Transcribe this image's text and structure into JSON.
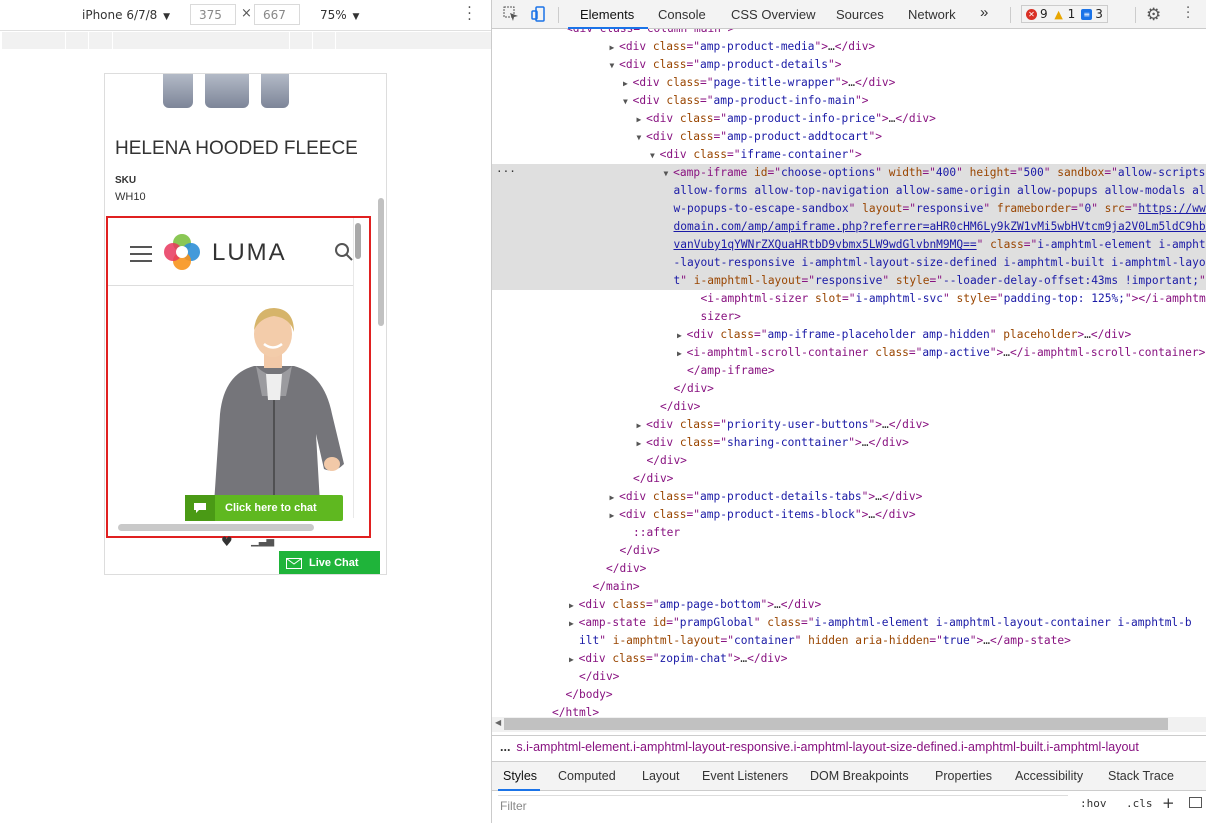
{
  "device_toolbar": {
    "device": "iPhone 6/7/8",
    "width": "375",
    "height": "667",
    "times": "×",
    "zoom": "75%"
  },
  "phone": {
    "product_title": "HELENA HOODED FLEECE",
    "sku_label": "SKU",
    "sku_value": "WH10",
    "brand": "LUMA",
    "chat_button": "Click here to chat",
    "live_chat": "Live Chat"
  },
  "devtools": {
    "tabs": [
      "Elements",
      "Console",
      "CSS Overview",
      "Sources",
      "Network"
    ],
    "more_tabs": "»",
    "errors": "9",
    "warnings": "1",
    "messages": "3",
    "breadcrumb": "s.i-amphtml-element.i-amphtml-layout-responsive.i-amphtml-layout-size-defined.i-amphtml-built.i-amphtml-layout",
    "bottom_tabs": [
      "Styles",
      "Computed",
      "Layout",
      "Event Listeners",
      "DOM Breakpoints",
      "Properties",
      "Accessibility",
      "Stack Trace"
    ],
    "filter_placeholder": "Filter",
    "hov": ":hov",
    "cls": ".cls",
    "plus": "+"
  },
  "dom_lines": [
    {
      "i": 5,
      "t": "▶",
      "seg": [
        [
          "tg",
          "<div "
        ],
        [
          "an",
          "class"
        ],
        [
          "tg",
          "=\""
        ],
        [
          "av",
          "amp-product-media"
        ],
        [
          "tg",
          "\">"
        ],
        [
          "tx",
          "…"
        ],
        [
          "tg",
          "</div>"
        ]
      ]
    },
    {
      "i": 5,
      "t": "▼",
      "seg": [
        [
          "tg",
          "<div "
        ],
        [
          "an",
          "class"
        ],
        [
          "tg",
          "=\""
        ],
        [
          "av",
          "amp-product-details"
        ],
        [
          "tg",
          "\">"
        ]
      ]
    },
    {
      "i": 6,
      "t": "▶",
      "seg": [
        [
          "tg",
          "<div "
        ],
        [
          "an",
          "class"
        ],
        [
          "tg",
          "=\""
        ],
        [
          "av",
          "page-title-wrapper"
        ],
        [
          "tg",
          "\">"
        ],
        [
          "tx",
          "…"
        ],
        [
          "tg",
          "</div>"
        ]
      ]
    },
    {
      "i": 6,
      "t": "▼",
      "seg": [
        [
          "tg",
          "<div "
        ],
        [
          "an",
          "class"
        ],
        [
          "tg",
          "=\""
        ],
        [
          "av",
          "amp-product-info-main"
        ],
        [
          "tg",
          "\">"
        ]
      ]
    },
    {
      "i": 7,
      "t": "▶",
      "seg": [
        [
          "tg",
          "<div "
        ],
        [
          "an",
          "class"
        ],
        [
          "tg",
          "=\""
        ],
        [
          "av",
          "amp-product-info-price"
        ],
        [
          "tg",
          "\">"
        ],
        [
          "tx",
          "…"
        ],
        [
          "tg",
          "</div>"
        ]
      ]
    },
    {
      "i": 7,
      "t": "▼",
      "seg": [
        [
          "tg",
          "<div "
        ],
        [
          "an",
          "class"
        ],
        [
          "tg",
          "=\""
        ],
        [
          "av",
          "amp-product-addtocart"
        ],
        [
          "tg",
          "\">"
        ]
      ]
    },
    {
      "i": 8,
      "t": "▼",
      "seg": [
        [
          "tg",
          "<div "
        ],
        [
          "an",
          "class"
        ],
        [
          "tg",
          "=\""
        ],
        [
          "av",
          "iframe-container"
        ],
        [
          "tg",
          "\">"
        ]
      ]
    },
    {
      "i": 9,
      "t": "▼",
      "hl": true,
      "seg": [
        [
          "tg",
          "<amp-iframe "
        ],
        [
          "an",
          "id"
        ],
        [
          "tg",
          "=\""
        ],
        [
          "av",
          "choose-options"
        ],
        [
          "tg",
          "\" "
        ],
        [
          "an",
          "width"
        ],
        [
          "tg",
          "=\""
        ],
        [
          "av",
          "400"
        ],
        [
          "tg",
          "\" "
        ],
        [
          "an",
          "height"
        ],
        [
          "tg",
          "=\""
        ],
        [
          "av",
          "500"
        ],
        [
          "tg",
          "\" "
        ],
        [
          "an",
          "sandbox"
        ],
        [
          "tg",
          "=\""
        ],
        [
          "av",
          "allow-scripts"
        ]
      ]
    },
    {
      "i": 9,
      "t": "",
      "hl": true,
      "seg": [
        [
          "av",
          "allow-forms allow-top-navigation allow-same-origin allow-popups allow-modals allo"
        ]
      ]
    },
    {
      "i": 9,
      "t": "",
      "hl": true,
      "seg": [
        [
          "av",
          "w-popups-to-escape-sandbox"
        ],
        [
          "tg",
          "\" "
        ],
        [
          "an",
          "layout"
        ],
        [
          "tg",
          "=\""
        ],
        [
          "av",
          "responsive"
        ],
        [
          "tg",
          "\" "
        ],
        [
          "an",
          "frameborder"
        ],
        [
          "tg",
          "=\""
        ],
        [
          "av",
          "0"
        ],
        [
          "tg",
          "\" "
        ],
        [
          "an",
          "src"
        ],
        [
          "tg",
          "=\""
        ],
        [
          "lk",
          "https://www."
        ]
      ]
    },
    {
      "i": 9,
      "t": "",
      "hl": true,
      "seg": [
        [
          "lk",
          "domain.com/amp/ampiframe.php?referrer=aHR0cHM6Ly9kZW1vMi5wbHVtcm9ja2V0Lm5ldC9hbX"
        ]
      ]
    },
    {
      "i": 9,
      "t": "",
      "hl": true,
      "seg": [
        [
          "lk",
          "vanVuby1qYWNrZXQuaHRtbD9vbmx5LW9wdGlvbnM9MQ=="
        ],
        [
          "tg",
          "\" "
        ],
        [
          "an",
          "class"
        ],
        [
          "tg",
          "=\""
        ],
        [
          "av",
          "i-amphtml-element i-amphtm"
        ]
      ]
    },
    {
      "i": 9,
      "t": "",
      "hl": true,
      "seg": [
        [
          "av",
          "-layout-responsive i-amphtml-layout-size-defined i-amphtml-built i-amphtml-layou"
        ]
      ]
    },
    {
      "i": 9,
      "t": "",
      "hl": true,
      "seg": [
        [
          "av",
          "t"
        ],
        [
          "tg",
          "\" "
        ],
        [
          "an",
          "i-amphtml-layout"
        ],
        [
          "tg",
          "=\""
        ],
        [
          "av",
          "responsive"
        ],
        [
          "tg",
          "\" "
        ],
        [
          "an",
          "style"
        ],
        [
          "tg",
          "=\""
        ],
        [
          "av",
          "--loader-delay-offset:43ms !important;"
        ],
        [
          "tg",
          "\">"
        ]
      ]
    },
    {
      "i": 11,
      "t": "",
      "seg": [
        [
          "tg",
          "<i-amphtml-sizer "
        ],
        [
          "an",
          "slot"
        ],
        [
          "tg",
          "=\""
        ],
        [
          "av",
          "i-amphtml-svc"
        ],
        [
          "tg",
          "\" "
        ],
        [
          "an",
          "style"
        ],
        [
          "tg",
          "=\""
        ],
        [
          "av",
          "padding-top: 125%;"
        ],
        [
          "tg",
          "\"></i-amphtml-"
        ]
      ]
    },
    {
      "i": 11,
      "t": "",
      "seg": [
        [
          "tg",
          "sizer>"
        ]
      ]
    },
    {
      "i": 10,
      "t": "▶",
      "seg": [
        [
          "tg",
          "<div "
        ],
        [
          "an",
          "class"
        ],
        [
          "tg",
          "=\""
        ],
        [
          "av",
          "amp-iframe-placeholder amp-hidden"
        ],
        [
          "tg",
          "\" "
        ],
        [
          "an",
          "placeholder"
        ],
        [
          "tg",
          ">"
        ],
        [
          "tx",
          "…"
        ],
        [
          "tg",
          "</div>"
        ]
      ]
    },
    {
      "i": 10,
      "t": "▶",
      "seg": [
        [
          "tg",
          "<i-amphtml-scroll-container "
        ],
        [
          "an",
          "class"
        ],
        [
          "tg",
          "=\""
        ],
        [
          "av",
          "amp-active"
        ],
        [
          "tg",
          "\">"
        ],
        [
          "tx",
          "…"
        ],
        [
          "tg",
          "</i-amphtml-scroll-container>"
        ]
      ]
    },
    {
      "i": 10,
      "t": "",
      "seg": [
        [
          "tg",
          "</amp-iframe>"
        ]
      ]
    },
    {
      "i": 9,
      "t": "",
      "seg": [
        [
          "tg",
          "</div>"
        ]
      ]
    },
    {
      "i": 8,
      "t": "",
      "seg": [
        [
          "tg",
          "</div>"
        ]
      ]
    },
    {
      "i": 7,
      "t": "▶",
      "seg": [
        [
          "tg",
          "<div "
        ],
        [
          "an",
          "class"
        ],
        [
          "tg",
          "=\""
        ],
        [
          "av",
          "priority-user-buttons"
        ],
        [
          "tg",
          "\">"
        ],
        [
          "tx",
          "…"
        ],
        [
          "tg",
          "</div>"
        ]
      ]
    },
    {
      "i": 7,
      "t": "▶",
      "seg": [
        [
          "tg",
          "<div "
        ],
        [
          "an",
          "class"
        ],
        [
          "tg",
          "=\""
        ],
        [
          "av",
          "sharing-conttainer"
        ],
        [
          "tg",
          "\">"
        ],
        [
          "tx",
          "…"
        ],
        [
          "tg",
          "</div>"
        ]
      ]
    },
    {
      "i": 7,
      "t": "",
      "seg": [
        [
          "tg",
          "</div>"
        ]
      ]
    },
    {
      "i": 6,
      "t": "",
      "seg": [
        [
          "tg",
          "</div>"
        ]
      ]
    },
    {
      "i": 5,
      "t": "▶",
      "seg": [
        [
          "tg",
          "<div "
        ],
        [
          "an",
          "class"
        ],
        [
          "tg",
          "=\""
        ],
        [
          "av",
          "amp-product-details-tabs"
        ],
        [
          "tg",
          "\">"
        ],
        [
          "tx",
          "…"
        ],
        [
          "tg",
          "</div>"
        ]
      ]
    },
    {
      "i": 5,
      "t": "▶",
      "seg": [
        [
          "tg",
          "<div "
        ],
        [
          "an",
          "class"
        ],
        [
          "tg",
          "=\""
        ],
        [
          "av",
          "amp-product-items-block"
        ],
        [
          "tg",
          "\">"
        ],
        [
          "tx",
          "…"
        ],
        [
          "tg",
          "</div>"
        ]
      ]
    },
    {
      "i": 6,
      "t": "",
      "seg": [
        [
          "tg",
          "::after"
        ]
      ]
    },
    {
      "i": 5,
      "t": "",
      "seg": [
        [
          "tg",
          "</div>"
        ]
      ]
    },
    {
      "i": 4,
      "t": "",
      "seg": [
        [
          "tg",
          "</div>"
        ]
      ]
    },
    {
      "i": 3,
      "t": "",
      "seg": [
        [
          "tg",
          "</main>"
        ]
      ]
    },
    {
      "i": 2,
      "t": "▶",
      "seg": [
        [
          "tg",
          "<div "
        ],
        [
          "an",
          "class"
        ],
        [
          "tg",
          "=\""
        ],
        [
          "av",
          "amp-page-bottom"
        ],
        [
          "tg",
          "\">"
        ],
        [
          "tx",
          "…"
        ],
        [
          "tg",
          "</div>"
        ]
      ]
    },
    {
      "i": 2,
      "t": "▶",
      "seg": [
        [
          "tg",
          "<amp-state "
        ],
        [
          "an",
          "id"
        ],
        [
          "tg",
          "=\""
        ],
        [
          "av",
          "prampGlobal"
        ],
        [
          "tg",
          "\" "
        ],
        [
          "an",
          "class"
        ],
        [
          "tg",
          "=\""
        ],
        [
          "av",
          "i-amphtml-element i-amphtml-layout-container i-amphtml-b"
        ]
      ]
    },
    {
      "i": 2,
      "t": "",
      "seg": [
        [
          "av",
          "ilt"
        ],
        [
          "tg",
          "\" "
        ],
        [
          "an",
          "i-amphtml-layout"
        ],
        [
          "tg",
          "=\""
        ],
        [
          "av",
          "container"
        ],
        [
          "tg",
          "\" "
        ],
        [
          "an",
          "hidden aria-hidden"
        ],
        [
          "tg",
          "=\""
        ],
        [
          "av",
          "true"
        ],
        [
          "tg",
          "\">"
        ],
        [
          "tx",
          "…"
        ],
        [
          "tg",
          "</amp-state>"
        ]
      ]
    },
    {
      "i": 2,
      "t": "▶",
      "seg": [
        [
          "tg",
          "<div "
        ],
        [
          "an",
          "class"
        ],
        [
          "tg",
          "=\""
        ],
        [
          "av",
          "zopim-chat"
        ],
        [
          "tg",
          "\">"
        ],
        [
          "tx",
          "…"
        ],
        [
          "tg",
          "</div>"
        ]
      ]
    },
    {
      "i": 2,
      "t": "",
      "seg": [
        [
          "tg",
          "</div>"
        ]
      ]
    },
    {
      "i": 1,
      "t": "",
      "seg": [
        [
          "tg",
          "</body>"
        ]
      ]
    },
    {
      "i": 0,
      "t": "",
      "seg": [
        [
          "tg",
          "</html>"
        ]
      ]
    }
  ]
}
